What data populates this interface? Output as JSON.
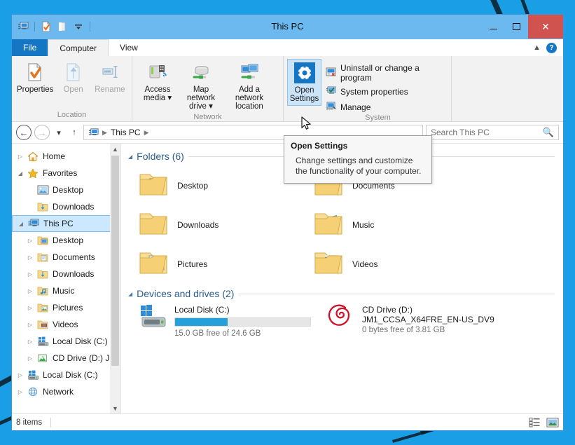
{
  "window": {
    "title": "This PC",
    "minimize_label": "Minimize",
    "maximize_label": "Maximize",
    "close_label": "Close"
  },
  "quick_access": [
    {
      "name": "this-pc-icon",
      "label": "This PC"
    },
    {
      "name": "properties-icon",
      "label": "Properties"
    },
    {
      "name": "new-folder-icon",
      "label": "New folder"
    },
    {
      "name": "customize-dropdown-icon",
      "label": "Customize Quick Access Toolbar"
    }
  ],
  "tabs": [
    {
      "label": "File",
      "id": "file"
    },
    {
      "label": "Computer",
      "id": "computer"
    },
    {
      "label": "View",
      "id": "view"
    }
  ],
  "tab_right": {
    "collapse_label": "Minimize the Ribbon",
    "help_label": "?"
  },
  "ribbon": {
    "groups": [
      {
        "label": "Location",
        "buttons": [
          {
            "label": "Properties",
            "icon": "properties-icon",
            "disabled": false,
            "selected": false
          },
          {
            "label": "Open",
            "icon": "open-icon",
            "disabled": true,
            "selected": false
          },
          {
            "label": "Rename",
            "icon": "rename-icon",
            "disabled": true,
            "selected": false
          }
        ]
      },
      {
        "label": "Network",
        "buttons": [
          {
            "label": "Access media",
            "icon": "access-media-icon",
            "disabled": false,
            "selected": false,
            "dropdown": true
          },
          {
            "label": "Map network drive",
            "icon": "map-network-drive-icon",
            "disabled": false,
            "selected": false,
            "dropdown": true
          },
          {
            "label": "Add a network location",
            "icon": "add-network-location-icon",
            "disabled": false,
            "selected": false,
            "dropdown": false
          }
        ]
      },
      {
        "label": "System",
        "buttons": [
          {
            "label": "Open Settings",
            "icon": "open-settings-icon",
            "disabled": false,
            "selected": true
          }
        ],
        "small_commands": [
          {
            "label": "Uninstall or change a program",
            "icon": "uninstall-program-icon"
          },
          {
            "label": "System properties",
            "icon": "system-properties-icon"
          },
          {
            "label": "Manage",
            "icon": "manage-icon"
          }
        ]
      }
    ]
  },
  "tooltip": {
    "title": "Open Settings",
    "body": "Change settings and customize the functionality of your computer."
  },
  "address_bar": {
    "back_label": "Back",
    "forward_label": "Forward",
    "recent_label": "Recent locations",
    "up_label": "Up one level",
    "breadcrumb": [
      "This PC"
    ],
    "search_placeholder": "Search This PC",
    "search_value": ""
  },
  "nav_tree": [
    {
      "label": "Home",
      "icon": "home-icon",
      "indent": 0,
      "expander": "collapsed",
      "selected": false
    },
    {
      "label": "Favorites",
      "icon": "favorites-star-icon",
      "indent": 0,
      "expander": "expanded",
      "selected": false
    },
    {
      "label": "Desktop",
      "icon": "desktop-icon",
      "indent": 1,
      "expander": "none",
      "selected": false
    },
    {
      "label": "Downloads",
      "icon": "downloads-folder-icon",
      "indent": 1,
      "expander": "none",
      "selected": false
    },
    {
      "label": "This PC",
      "icon": "this-pc-icon",
      "indent": 0,
      "expander": "expanded",
      "selected": true
    },
    {
      "label": "Desktop",
      "icon": "desktop-folder-icon",
      "indent": 1,
      "expander": "collapsed",
      "selected": false
    },
    {
      "label": "Documents",
      "icon": "documents-folder-icon",
      "indent": 1,
      "expander": "collapsed",
      "selected": false
    },
    {
      "label": "Downloads",
      "icon": "downloads-folder-icon",
      "indent": 1,
      "expander": "collapsed",
      "selected": false
    },
    {
      "label": "Music",
      "icon": "music-folder-icon",
      "indent": 1,
      "expander": "collapsed",
      "selected": false
    },
    {
      "label": "Pictures",
      "icon": "pictures-folder-icon",
      "indent": 1,
      "expander": "collapsed",
      "selected": false
    },
    {
      "label": "Videos",
      "icon": "videos-folder-icon",
      "indent": 1,
      "expander": "collapsed",
      "selected": false
    },
    {
      "label": "Local Disk (C:)",
      "icon": "local-disk-icon",
      "indent": 1,
      "expander": "collapsed",
      "selected": false
    },
    {
      "label": "CD Drive (D:) J",
      "icon": "cd-drive-icon",
      "indent": 1,
      "expander": "collapsed",
      "selected": false
    },
    {
      "label": "Local Disk (C:)",
      "icon": "local-disk-icon",
      "indent": 0,
      "expander": "collapsed",
      "selected": false
    },
    {
      "label": "Network",
      "icon": "network-icon",
      "indent": 0,
      "expander": "collapsed",
      "selected": false
    }
  ],
  "content": {
    "folders_section": {
      "title": "Folders (6)",
      "items": [
        {
          "label": "Desktop",
          "icon": "desktop-folder-icon"
        },
        {
          "label": "Documents",
          "icon": "documents-folder-icon"
        },
        {
          "label": "Downloads",
          "icon": "downloads-folder-icon"
        },
        {
          "label": "Music",
          "icon": "music-folder-icon"
        },
        {
          "label": "Pictures",
          "icon": "pictures-folder-icon"
        },
        {
          "label": "Videos",
          "icon": "videos-folder-icon"
        }
      ]
    },
    "drives_section": {
      "title": "Devices and drives (2)",
      "drives": [
        {
          "name": "Local Disk (C:)",
          "icon": "local-disk-windows-icon",
          "capacity_text": "15.0 GB free of 24.6 GB",
          "used_percent": 39,
          "bar_color": "#26a0da",
          "subtitle": ""
        },
        {
          "name": "CD Drive (D:)",
          "icon": "cd-drive-debian-icon",
          "subtitle": "JM1_CCSA_X64FRE_EN-US_DV9",
          "capacity_text": "0 bytes free of 3.81 GB",
          "used_percent": 100,
          "bar_color": ""
        }
      ]
    }
  },
  "status_bar": {
    "item_count": "8 items",
    "view_details_label": "Details view",
    "view_large_icons_label": "Large icons view"
  },
  "colors": {
    "titlebar": "#6cb9ef",
    "file_tab": "#1577c4",
    "accent": "#26a0da",
    "selection": "#cce8ff",
    "close_button": "#d0534f",
    "desktop": "#1a9ee6",
    "section_title": "#2a5d8f"
  }
}
